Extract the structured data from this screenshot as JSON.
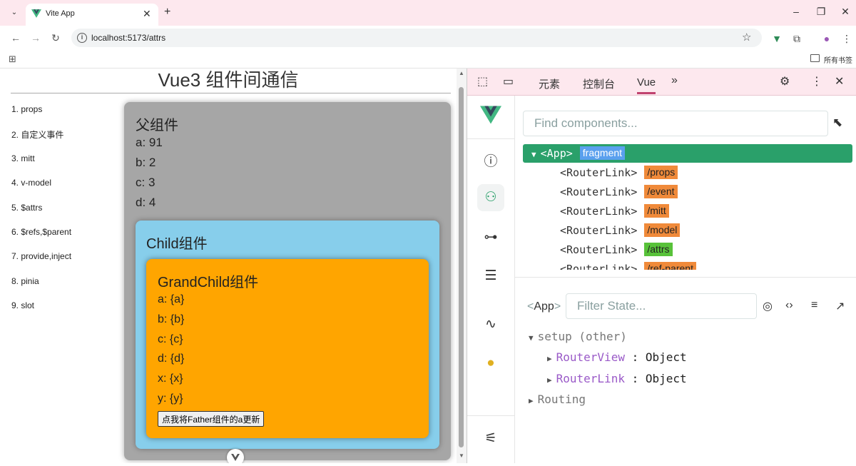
{
  "browser": {
    "tab_title": "Vite App",
    "url": "localhost:5173/attrs",
    "bookmark_folder": "所有书签"
  },
  "page": {
    "title": "Vue3 组件间通信",
    "nav": [
      "1. props",
      "2. 自定义事件",
      "3. mitt",
      "4. v-model",
      "5. $attrs",
      "6. $refs,$parent",
      "7. provide,inject",
      "8. pinia",
      "9. slot"
    ],
    "father": {
      "title": "父组件",
      "lines": [
        "a: 91",
        "b: 2",
        "c: 3",
        "d: 4"
      ]
    },
    "child": {
      "title": "Child组件"
    },
    "grandchild": {
      "title": "GrandChild组件",
      "lines": [
        "a: {a}",
        "b: {b}",
        "c: {c}",
        "d: {d}",
        "x: {x}",
        "y: {y}"
      ],
      "button": "点我将Father组件的a更新"
    }
  },
  "devtools": {
    "tabs": [
      "元素",
      "控制台",
      "Vue"
    ],
    "active_tab": "Vue",
    "find_placeholder": "Find components...",
    "tree": {
      "root": "<App>",
      "root_badge": "fragment",
      "links": [
        {
          "tag": "<RouterLink>",
          "path": "/props",
          "active": false
        },
        {
          "tag": "<RouterLink>",
          "path": "/event",
          "active": false
        },
        {
          "tag": "<RouterLink>",
          "path": "/mitt",
          "active": false
        },
        {
          "tag": "<RouterLink>",
          "path": "/model",
          "active": false
        },
        {
          "tag": "<RouterLink>",
          "path": "/attrs",
          "active": true
        },
        {
          "tag": "<RouterLink>",
          "path": "/ref-parent",
          "active": false
        }
      ]
    },
    "state": {
      "component": "App",
      "filter_placeholder": "Filter State...",
      "group": "setup (other)",
      "entries": [
        {
          "key": "RouterView",
          "value": "Object"
        },
        {
          "key": "RouterLink",
          "value": "Object"
        }
      ],
      "routing": "Routing"
    },
    "colors": {
      "vue_green": "#42b883",
      "selected_row": "#2aa06a",
      "badge_orange": "#f08a3a",
      "badge_green": "#58c23a"
    }
  }
}
